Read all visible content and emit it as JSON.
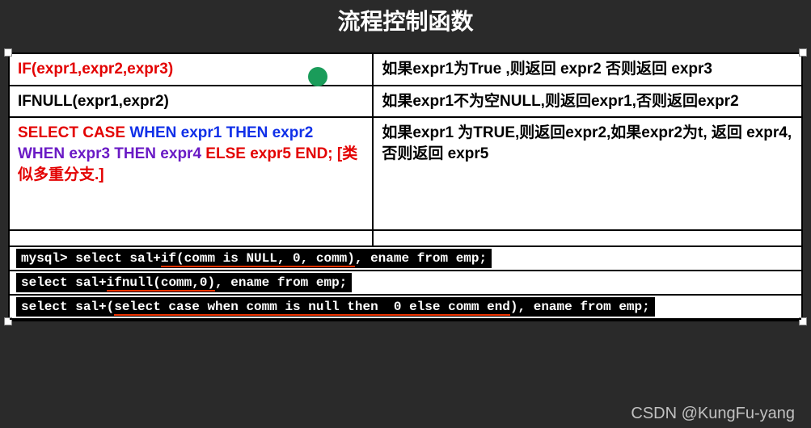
{
  "title": "流程控制函数",
  "rows": [
    {
      "left_html": {
        "parts": [
          {
            "cls": "red-txt",
            "text": "IF(expr1,expr2,expr3)"
          }
        ]
      },
      "right": "如果expr1为True ,则返回 expr2 否则返回 expr3",
      "has_dot": true
    },
    {
      "left_html": {
        "parts": [
          {
            "cls": "black-txt",
            "text": "IFNULL(expr1,expr2)"
          }
        ]
      },
      "right": "如果expr1不为空NULL,则返回expr1,否则返回expr2"
    },
    {
      "left_html": {
        "parts": [
          {
            "cls": "red-txt",
            "text": "SELECT CASE "
          },
          {
            "cls": "blue-txt",
            "text": "WHEN expr1 THEN expr2 "
          },
          {
            "cls": "purple-txt",
            "text": "WHEN expr3 THEN expr4 "
          },
          {
            "cls": "red-txt",
            "text": "ELSE expr5 END; "
          },
          {
            "cls": "red-txt",
            "text": "[类似多重分支.]"
          }
        ]
      },
      "right": "如果expr1 为TRUE,则返回expr2,如果expr2为t, 返回 expr4, 否则返回 expr5",
      "tall": true
    }
  ],
  "code_lines": [
    {
      "prefix": "mysql> select sal+",
      "underlined": "if(comm is NULL, 0, comm)",
      "suffix": ", ename from emp;"
    },
    {
      "prefix": "select sal+",
      "underlined": "ifnull(comm,0)",
      "suffix": ", ename from emp;"
    },
    {
      "prefix": "select sal+(",
      "underlined": "select case when comm is null then  0 else comm end",
      "suffix": "), ename from emp;"
    }
  ],
  "watermark": "CSDN @KungFu-yang"
}
